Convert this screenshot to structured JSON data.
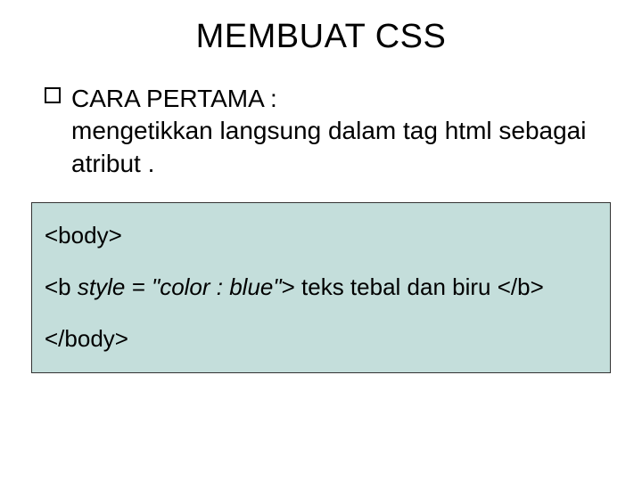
{
  "title": "MEMBUAT CSS",
  "bullet": {
    "heading": "CARA PERTAMA :",
    "desc": "mengetikkan langsung dalam tag html sebagai atribut ."
  },
  "code": {
    "line1": "<body>",
    "line2_prefix": "<b ",
    "line2_attr": "style = \"color : blue\"",
    "line2_suffix": "> teks tebal dan biru </b>",
    "line3": "</body>"
  }
}
